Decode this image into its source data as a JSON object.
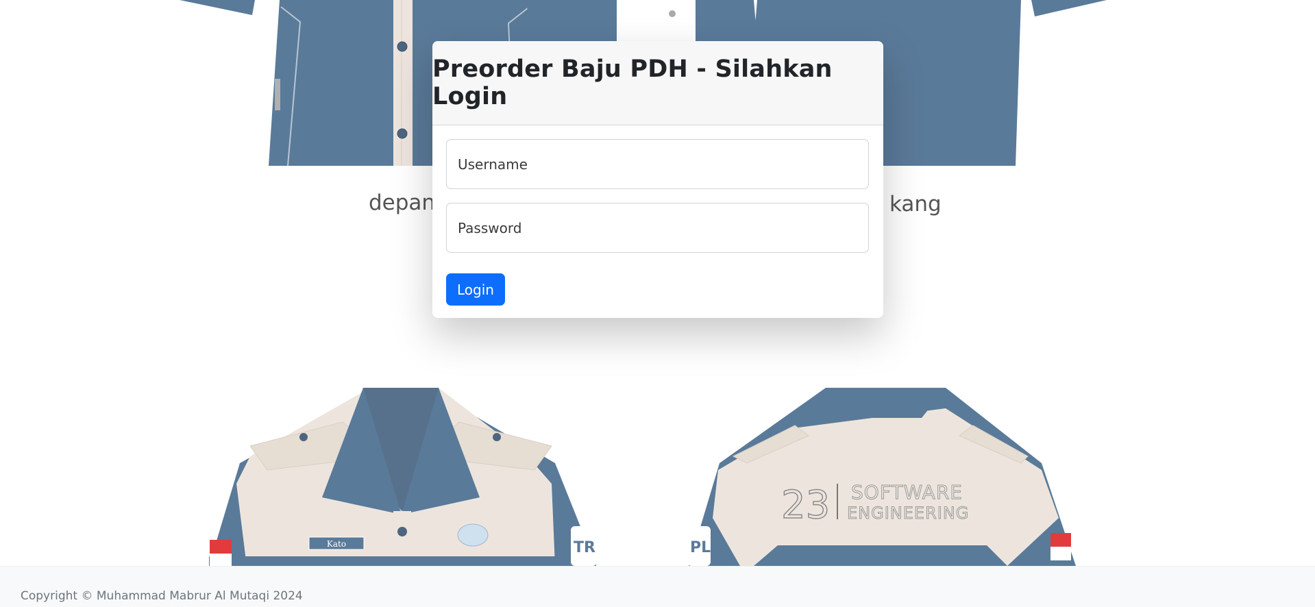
{
  "background": {
    "front_label": "depan",
    "back_label": "kang",
    "name_tag": "Kato",
    "back_print_number": "23",
    "back_print_line1": "SOFTWARE",
    "back_print_line2": "ENGINEERING",
    "colors": {
      "shirt_blue": "#5a7a99",
      "shirt_cream": "#ede5dd"
    }
  },
  "login": {
    "title": "Preorder Baju PDH - Silahkan Login",
    "username_placeholder": "Username",
    "username_value": "",
    "password_placeholder": "Password",
    "password_value": "",
    "button_label": "Login",
    "button_color": "#0d6efd"
  },
  "footer": {
    "copyright": "Copyright © Muhammad Mabrur Al Mutaqi 2024"
  }
}
